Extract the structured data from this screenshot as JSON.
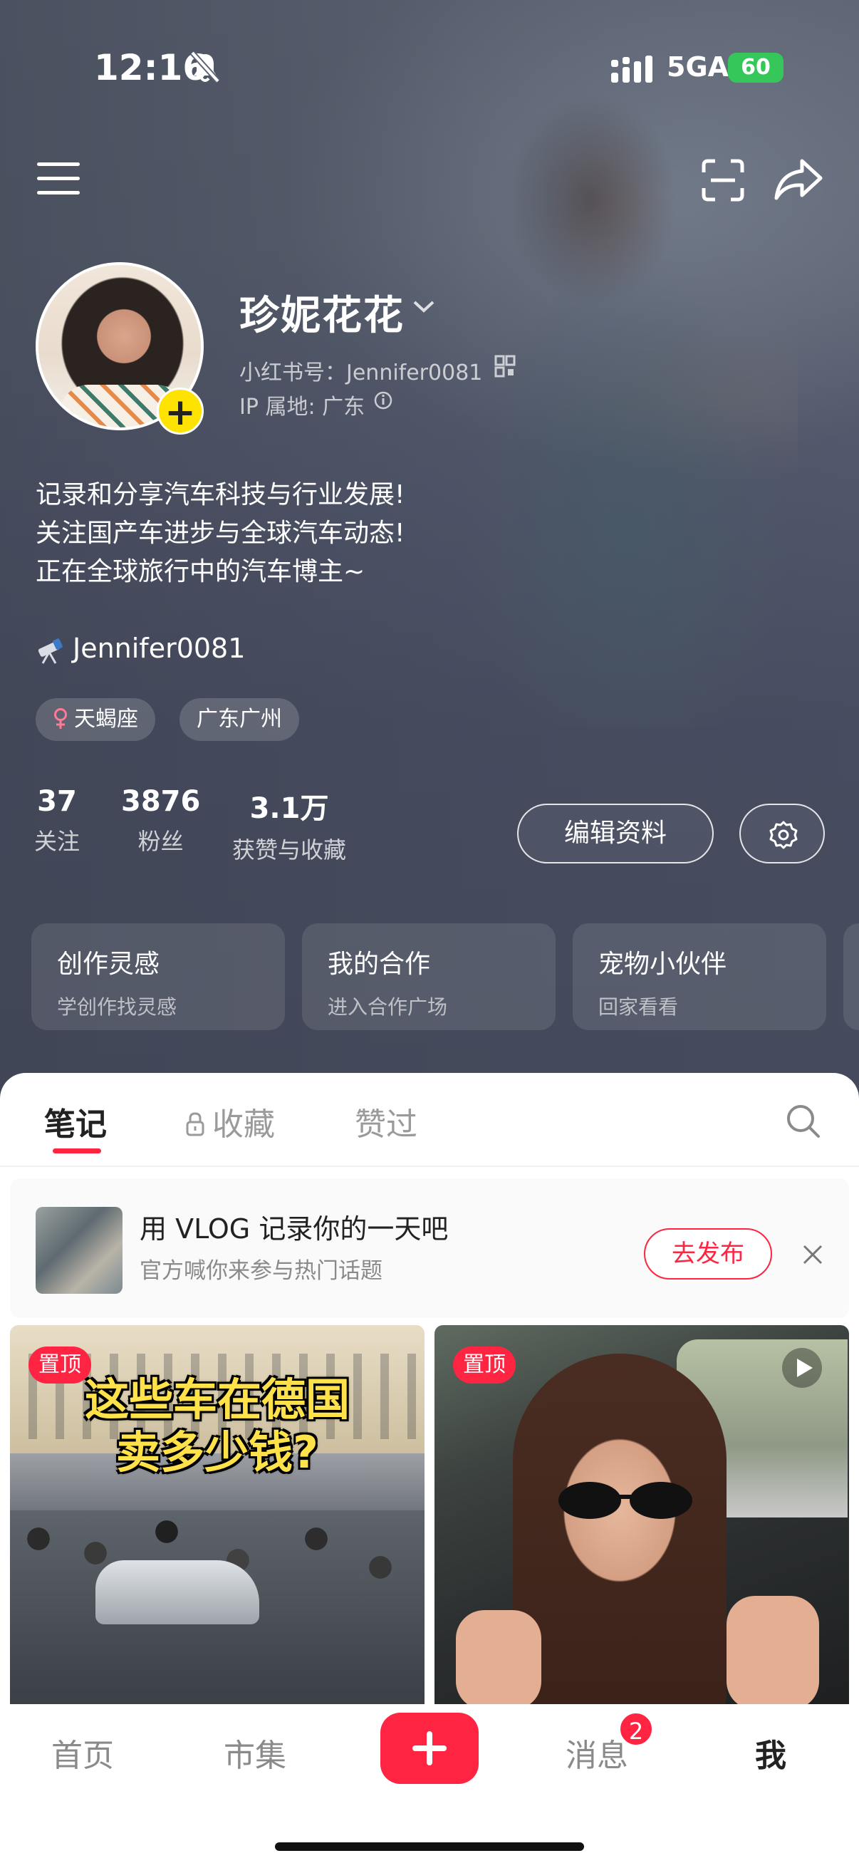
{
  "status_bar": {
    "time": "12:16",
    "network": "5GA",
    "battery": "60"
  },
  "profile": {
    "nickname": "珍妮花花",
    "red_id_line": "小红书号：Jennifer0081",
    "ip_line": "IP 属地: 广东",
    "bio": [
      "记录和分享汽车科技与行业发展!",
      "关注国产车进步与全球汽车动态!",
      "正在全球旅行中的汽车博主~"
    ],
    "link_text": "Jennifer0081",
    "tags": [
      "天蝎座",
      "广东广州"
    ],
    "stats": [
      {
        "num": "37",
        "label": "关注"
      },
      {
        "num": "3876",
        "label": "粉丝"
      },
      {
        "num": "3.1万",
        "label": "获赞与收藏"
      }
    ],
    "edit_button": "编辑资料"
  },
  "cards": [
    {
      "title": "创作灵感",
      "sub": "学创作找灵感"
    },
    {
      "title": "我的合作",
      "sub": "进入合作广场"
    },
    {
      "title": "宠物小伙伴",
      "sub": "回家看看"
    }
  ],
  "tabs": [
    "笔记",
    "收藏",
    "赞过"
  ],
  "promo": {
    "title": "用 VLOG 记录你的一天吧",
    "subtitle": "官方喊你来参与热门话题",
    "button": "去发布"
  },
  "posts": [
    {
      "badge": "置顶",
      "headline": [
        "这些车在德国",
        "卖多少钱?"
      ]
    },
    {
      "badge": "置顶"
    }
  ],
  "bottom_nav": {
    "items": [
      "首页",
      "市集",
      "消息",
      "我"
    ],
    "messages_badge": "2"
  },
  "colors": {
    "accent": "#ff2442",
    "avatar_add": "#ffe300",
    "battery": "#35c759"
  }
}
